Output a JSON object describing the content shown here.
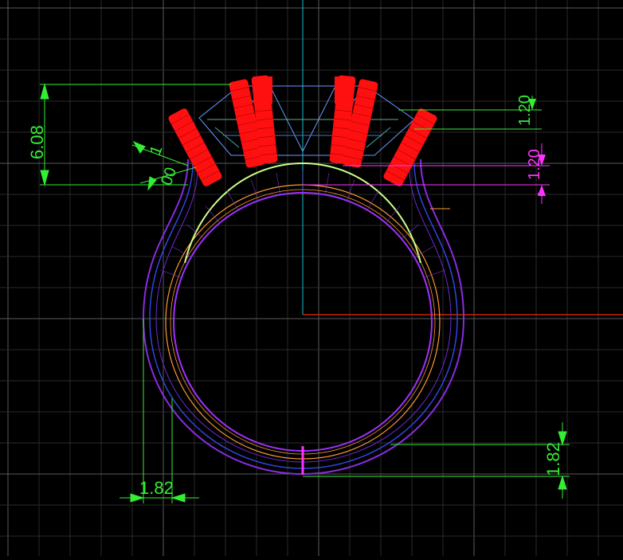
{
  "viewport": {
    "background": "#000000",
    "grid_color_minor": "#2a2a2a",
    "grid_color_major": "#5a5a5a"
  },
  "colors": {
    "dimension_green": "#33ee33",
    "dimension_magenta": "#ff33ff",
    "prong_red": "#ff1010",
    "gem_blue": "#6699ff",
    "shank_purple": "#8a2be2",
    "shank_blue": "#3344dd",
    "inner_orange": "#ff9933",
    "inner_green": "#ccff88",
    "axis_cyan": "#22bbcc",
    "axis_red": "#cc2200"
  },
  "dimensions": {
    "height_total": "6.08",
    "prong_angle_label_a": "1",
    "prong_angle_label_b": "00",
    "top_gap_1": "1.20",
    "top_gap_2": "1.20",
    "shank_width_bottom": "1.82",
    "shank_thickness_right": "1.82"
  }
}
